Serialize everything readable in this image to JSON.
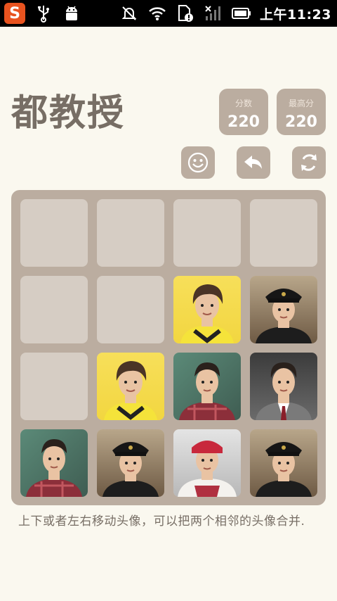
{
  "status_bar": {
    "time": "上午11:23",
    "icons": [
      "sogou-input-icon",
      "usb-icon",
      "android-debug-icon",
      "alarm-off-icon",
      "wifi-icon",
      "sim-alert-icon",
      "signal-off-icon",
      "battery-icon"
    ]
  },
  "game": {
    "title": "都教授",
    "score_label": "分数",
    "score": "220",
    "best_label": "最高分",
    "best": "220",
    "hint": "上下或者左右移动头像，可以把两个相邻的头像合并."
  },
  "controls": [
    "face-button",
    "undo-button",
    "restart-button"
  ],
  "board": {
    "rows": [
      [
        "empty",
        "empty",
        "empty",
        "empty"
      ],
      [
        "empty",
        "empty",
        "yellow-jersey",
        "military-cap"
      ],
      [
        "empty",
        "yellow-jersey",
        "plaid-shirt",
        "school-uniform"
      ],
      [
        "plaid-shirt",
        "military-cap",
        "red-headband",
        "military-cap"
      ]
    ]
  },
  "colors": {
    "background": "#faf8ef",
    "board": "#bbada0",
    "empty_cell": "#d6cdc4",
    "text": "#776e65"
  }
}
